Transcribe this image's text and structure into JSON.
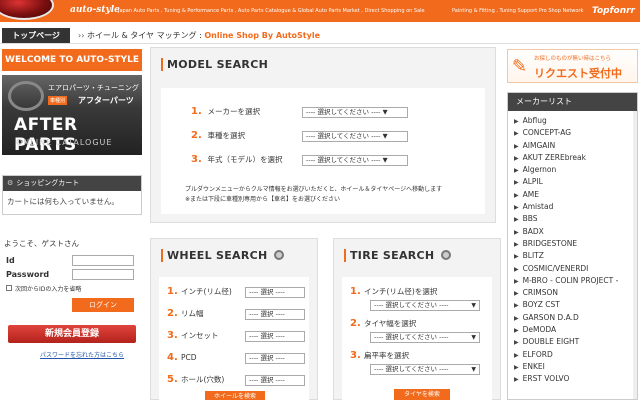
{
  "header": {
    "logo": "auto-style",
    "tagline": "Japan Auto Parts , Tuning & Performance Parts , Auto Parts Catalogue & Global Auto Parts Market , Direct Shopping on Sale",
    "tagline2": "Painting & Fitting , Tuning Support Pro Shop Network",
    "brand": "Topfonrr"
  },
  "breadcrumb": {
    "home": "トップページ",
    "separator": "››",
    "current": "ホイール & タイヤ マッチング : ",
    "site": "Online Shop By AutoStyle"
  },
  "sidebar": {
    "welcome": "WELCOME TO AUTO-STYLE",
    "banner": {
      "line1": "エアロパーツ・チューニング",
      "badge": "車種別",
      "line2": "アフターパーツ",
      "big": "AFTER PARTS",
      "sub": "ONLINE CATALOGUE"
    },
    "cart": {
      "title": "ショッピングカート",
      "body": "カートには何も入っていません。"
    },
    "login": {
      "greeting": "ようこそ、ゲストさん",
      "id_label": "Id",
      "password_label": "Password",
      "remember": "次回からIDの入力を省略",
      "button": "ログイン"
    },
    "register": "新規会員登録",
    "forgot": "パスワードを忘れた方はこちら"
  },
  "model_search": {
    "title": "MODEL SEARCH",
    "rows": [
      {
        "num": "1.",
        "label": "メーカーを選択"
      },
      {
        "num": "2.",
        "label": "車種を選択"
      },
      {
        "num": "3.",
        "label": "年式（モデル）を選択"
      }
    ],
    "select_text": "---- 選択してください ---- ▼",
    "note1": "プルダウンメニューからクルマ情報をお選びいただくと、ホイール＆タイヤページへ移動します",
    "note2": "※または下段に車種別専用から【車名】をお選びください"
  },
  "wheel_search": {
    "title": "WHEEL SEARCH",
    "rows": [
      {
        "num": "1.",
        "label": "インチ(リム径)"
      },
      {
        "num": "2.",
        "label": "リム幅"
      },
      {
        "num": "3.",
        "label": "インセット"
      },
      {
        "num": "4.",
        "label": "PCD"
      },
      {
        "num": "5.",
        "label": "ホール(穴数)"
      }
    ],
    "select_text": "---- 選択 ----",
    "button": "ホイールを検索"
  },
  "tire_search": {
    "title": "TIRE SEARCH",
    "rows": [
      {
        "num": "1.",
        "label": "インチ(リム径)を選択"
      },
      {
        "num": "2.",
        "label": "タイヤ幅を選択"
      },
      {
        "num": "3.",
        "label": "扁平率を選択"
      }
    ],
    "select_text": "---- 選択してください ----",
    "button": "タイヤを検索"
  },
  "request": {
    "small": "お探しのものが無い時はこちら",
    "big": "リクエスト受付中"
  },
  "maker_list": {
    "title": "メーカーリスト",
    "items": [
      "Abflug",
      "CONCEPT-AG",
      "AIMGAIN",
      "AKUT ZEREbreak",
      "Algernon",
      "ALPIL",
      "AME",
      "Amistad",
      "BBS",
      "BADX",
      "BRIDGESTONE",
      "BLITZ",
      "COSMIC/VENERDI",
      "M-BRO - COLIN PROJECT -",
      "CRIMSON",
      "BOYZ CST",
      "GARSON D.A.D",
      "DeMODA",
      "DOUBLE EIGHT",
      "ELFORD",
      "ENKEI",
      "ERST VOLVO"
    ]
  }
}
